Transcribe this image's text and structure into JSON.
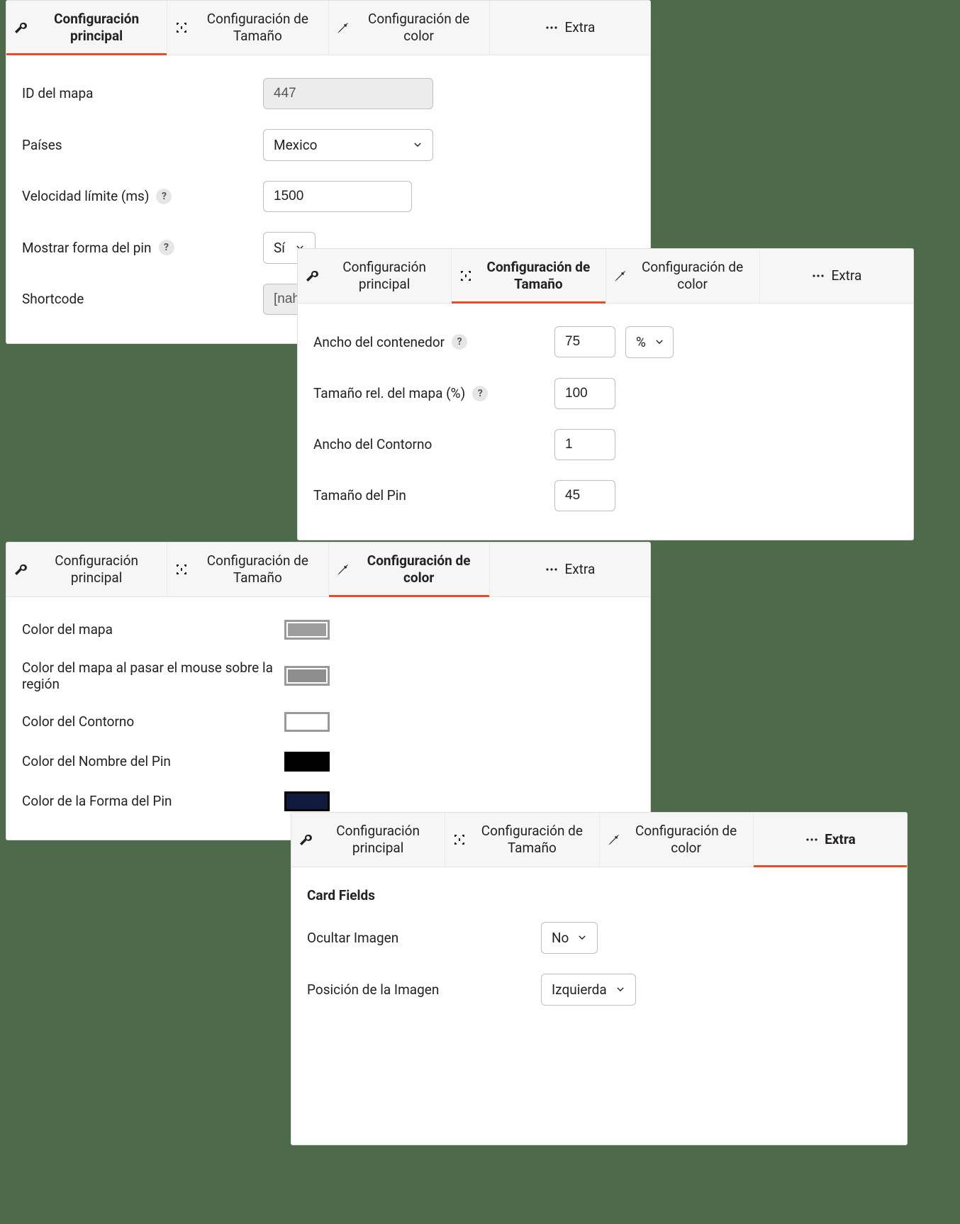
{
  "tabs": {
    "main": "Configuración principal",
    "size": "Configuración de Tamaño",
    "color": "Configuración de color",
    "extra": "Extra"
  },
  "panel_main": {
    "map_id_label": "ID del mapa",
    "map_id_value": "447",
    "countries_label": "Países",
    "countries_value": "Mexico",
    "throttle_label": "Velocidad límite (ms)",
    "throttle_value": "1500",
    "show_pin_shape_label": "Mostrar forma del pin",
    "show_pin_shape_value": "Sí",
    "shortcode_label": "Shortcode",
    "shortcode_value": "[nahi"
  },
  "panel_size": {
    "container_width_label": "Ancho del contenedor",
    "container_width_value": "75",
    "container_width_unit": "%",
    "rel_size_label": "Tamaño rel. del mapa (%)",
    "rel_size_value": "100",
    "outline_width_label": "Ancho del Contorno",
    "outline_width_value": "1",
    "pin_size_label": "Tamaño del Pin",
    "pin_size_value": "45"
  },
  "panel_color": {
    "map_color_label": "Color del mapa",
    "map_color_value": "#9c9c9c",
    "map_hover_color_label": "Color del mapa al pasar el mouse sobre la región",
    "map_hover_color_value": "#8e8e8e",
    "outline_color_label": "Color del Contorno",
    "outline_color_value": "#ffffff",
    "pin_name_color_label": "Color del Nombre del Pin",
    "pin_name_color_value": "#000000",
    "pin_shape_color_label": "Color de la Forma del Pin",
    "pin_shape_color_value": "#101a3f"
  },
  "panel_extra": {
    "section_title": "Card Fields",
    "hide_image_label": "Ocultar Imagen",
    "hide_image_value": "No",
    "image_position_label": "Posición de la Imagen",
    "image_position_value": "Izquierda"
  }
}
